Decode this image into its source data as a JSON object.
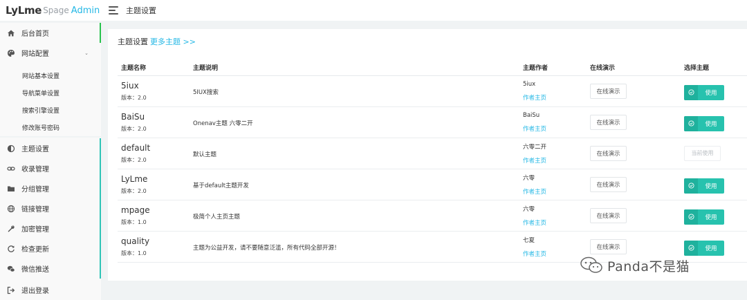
{
  "brand": {
    "part1": "LyLme",
    "part2": "Spage",
    "part3": "Admin"
  },
  "header": {
    "breadcrumb": "主题设置"
  },
  "sidebar": {
    "items": [
      {
        "label": "后台首页",
        "icon": "home-icon"
      },
      {
        "label": "网站配置",
        "icon": "palette-icon"
      },
      {
        "label": "主题设置",
        "icon": "half-circle-icon"
      },
      {
        "label": "收录管理",
        "icon": "link-icon"
      },
      {
        "label": "分组管理",
        "icon": "folder-icon"
      },
      {
        "label": "链接管理",
        "icon": "globe-icon"
      },
      {
        "label": "加密管理",
        "icon": "wrench-icon"
      },
      {
        "label": "检查更新",
        "icon": "refresh-icon"
      },
      {
        "label": "微信推送",
        "icon": "wechat-icon"
      },
      {
        "label": "退出登录",
        "icon": "logout-icon"
      }
    ],
    "submenu": [
      "网站基本设置",
      "导航菜单设置",
      "搜索引擎设置",
      "修改账号密码"
    ]
  },
  "card": {
    "title": "主题设置",
    "more_link": "更多主题 >>"
  },
  "table": {
    "headers": [
      "主题名称",
      "主题说明",
      "主题作者",
      "在线演示",
      "选择主题"
    ],
    "rows": [
      {
        "name": "5iux",
        "version": "版本：2.0",
        "desc": "5IUX搜索",
        "author": "5iux",
        "author_link": "作者主页",
        "demo": "在线演示",
        "action": "使用"
      },
      {
        "name": "BaiSu",
        "version": "版本：2.0",
        "desc": "Onenav主题 六零二开",
        "author": "BaiSu",
        "author_link": "作者主页",
        "demo": "在线演示",
        "action": "使用"
      },
      {
        "name": "default",
        "version": "版本：2.0",
        "desc": "默认主题",
        "author": "六零二开",
        "author_link": "作者主页",
        "demo": "在线演示",
        "action": "当前使用"
      },
      {
        "name": "LyLme",
        "version": "版本：2.0",
        "desc": "基于default主题开发",
        "author": "六零",
        "author_link": "作者主页",
        "demo": "在线演示",
        "action": "使用"
      },
      {
        "name": "mpage",
        "version": "版本：1.0",
        "desc": "极简个人主页主题",
        "author": "六零",
        "author_link": "作者主页",
        "demo": "在线演示",
        "action": "使用"
      },
      {
        "name": "quality",
        "version": "版本：1.0",
        "desc": "主题为公益开发，请不要随意泛滥，所有代码全部开源！",
        "author": "七夏",
        "author_link": "作者主页",
        "demo": "在线演示",
        "action": "使用"
      }
    ]
  },
  "watermark": {
    "text": "Panda不是猫",
    "icon": "wechat-icon"
  },
  "colors": {
    "accent": "#23b7e5",
    "use_button": "#27c2ae",
    "active_border": "#27c24c"
  }
}
